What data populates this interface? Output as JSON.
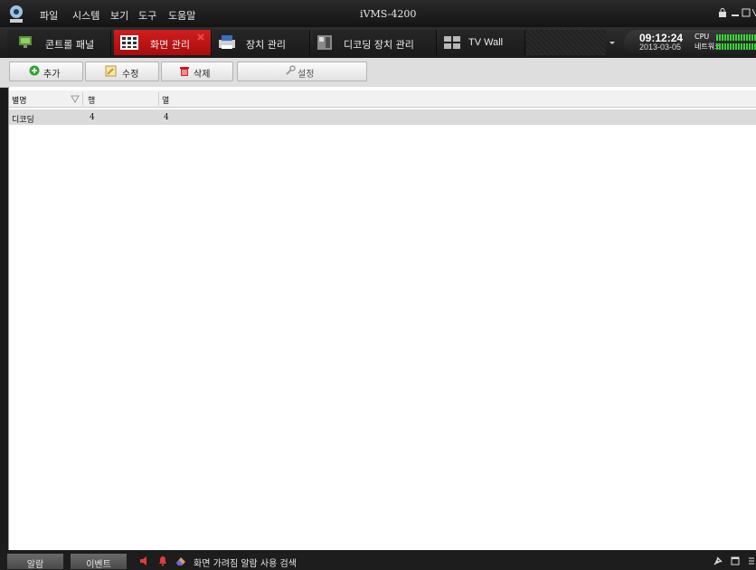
{
  "app": {
    "title": "iVMS-4200"
  },
  "menu": {
    "items": [
      "파일",
      "시스템",
      "보기",
      "도구",
      "도움말"
    ]
  },
  "tabs": [
    {
      "label": "콘트롤 패널",
      "icon": "control-panel-icon",
      "active": false
    },
    {
      "label": "화면 관리",
      "icon": "screen-grid-icon",
      "active": true
    },
    {
      "label": "장치 관리",
      "icon": "device-printer-icon",
      "active": false
    },
    {
      "label": "디코딩 장치 관리",
      "icon": "decoder-device-icon",
      "active": false
    },
    {
      "label": "TV Wall",
      "icon": "tv-wall-icon",
      "active": false
    }
  ],
  "clock": {
    "time": "09:12:24",
    "date": "2013-03-05"
  },
  "resources": {
    "cpu_label": "CPU",
    "network_label": "네트워크"
  },
  "toolbar": {
    "add_label": "추가",
    "edit_label": "수정",
    "delete_label": "삭제",
    "settings_label": "설정"
  },
  "table": {
    "columns": [
      "별명",
      "행",
      "열"
    ],
    "rows": [
      [
        "디코딩",
        "4",
        "4"
      ]
    ]
  },
  "statusbar": {
    "alarm_tab": "알람",
    "event_tab": "이벤트",
    "message": "화면 가려짐 알람 사용 검색"
  },
  "colors": {
    "accent_red": "#c41414",
    "meter_green": "#3ad33a"
  }
}
